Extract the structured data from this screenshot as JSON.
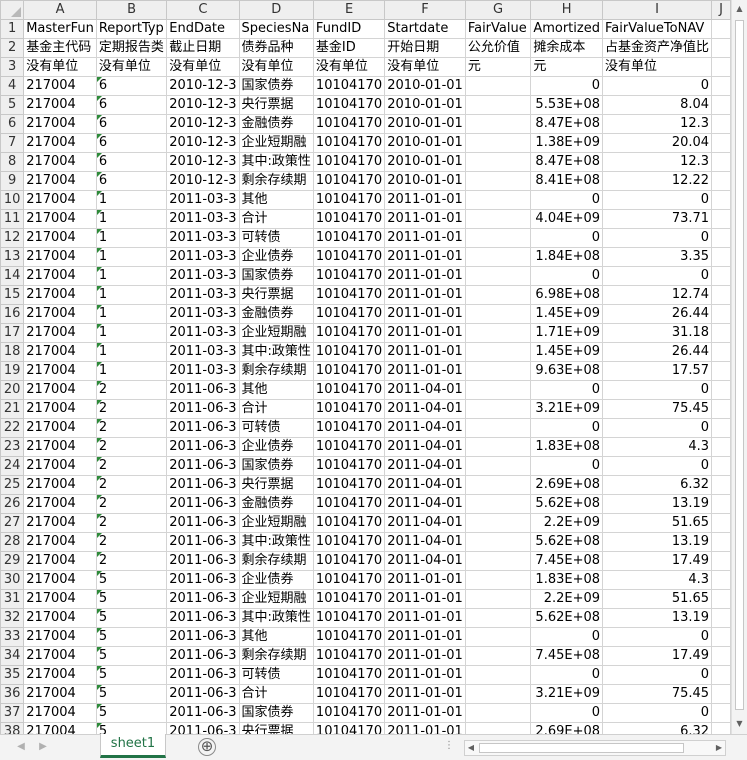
{
  "columns": [
    "A",
    "B",
    "C",
    "D",
    "E",
    "F",
    "G",
    "H",
    "I",
    "J"
  ],
  "rows": [
    {
      "n": "1",
      "c": [
        "MasterFun",
        "ReportTyp",
        "EndDate",
        "SpeciesNa",
        "FundID",
        "Startdate",
        "FairValue",
        "Amortized",
        "FairValueToNAV",
        ""
      ]
    },
    {
      "n": "2",
      "c": [
        "基金主代码",
        "定期报告类",
        "截止日期",
        "债券品种",
        "基金ID",
        "开始日期",
        "公允价值",
        "摊余成本",
        "占基金资产净值比",
        ""
      ]
    },
    {
      "n": "3",
      "c": [
        "没有单位",
        "没有单位",
        "没有单位",
        "没有单位",
        "没有单位",
        "没有单位",
        "元",
        "元",
        "没有单位",
        ""
      ]
    },
    {
      "n": "4",
      "c": [
        "217004",
        "6",
        "2010-12-3",
        "国家债券",
        "10104170",
        "2010-01-01",
        "",
        "0",
        "0",
        ""
      ]
    },
    {
      "n": "5",
      "c": [
        "217004",
        "6",
        "2010-12-3",
        "央行票据",
        "10104170",
        "2010-01-01",
        "",
        "5.53E+08",
        "8.04",
        ""
      ]
    },
    {
      "n": "6",
      "c": [
        "217004",
        "6",
        "2010-12-3",
        "金融债券",
        "10104170",
        "2010-01-01",
        "",
        "8.47E+08",
        "12.3",
        ""
      ]
    },
    {
      "n": "7",
      "c": [
        "217004",
        "6",
        "2010-12-3",
        "企业短期融",
        "10104170",
        "2010-01-01",
        "",
        "1.38E+09",
        "20.04",
        ""
      ]
    },
    {
      "n": "8",
      "c": [
        "217004",
        "6",
        "2010-12-3",
        "其中:政策性",
        "10104170",
        "2010-01-01",
        "",
        "8.47E+08",
        "12.3",
        ""
      ]
    },
    {
      "n": "9",
      "c": [
        "217004",
        "6",
        "2010-12-3",
        "剩余存续期",
        "10104170",
        "2010-01-01",
        "",
        "8.41E+08",
        "12.22",
        ""
      ]
    },
    {
      "n": "10",
      "c": [
        "217004",
        "1",
        "2011-03-3",
        "其他",
        "10104170",
        "2011-01-01",
        "",
        "0",
        "0",
        ""
      ]
    },
    {
      "n": "11",
      "c": [
        "217004",
        "1",
        "2011-03-3",
        "合计",
        "10104170",
        "2011-01-01",
        "",
        "4.04E+09",
        "73.71",
        ""
      ]
    },
    {
      "n": "12",
      "c": [
        "217004",
        "1",
        "2011-03-3",
        "可转债",
        "10104170",
        "2011-01-01",
        "",
        "0",
        "0",
        ""
      ]
    },
    {
      "n": "13",
      "c": [
        "217004",
        "1",
        "2011-03-3",
        "企业债券",
        "10104170",
        "2011-01-01",
        "",
        "1.84E+08",
        "3.35",
        ""
      ]
    },
    {
      "n": "14",
      "c": [
        "217004",
        "1",
        "2011-03-3",
        "国家债券",
        "10104170",
        "2011-01-01",
        "",
        "0",
        "0",
        ""
      ]
    },
    {
      "n": "15",
      "c": [
        "217004",
        "1",
        "2011-03-3",
        "央行票据",
        "10104170",
        "2011-01-01",
        "",
        "6.98E+08",
        "12.74",
        ""
      ]
    },
    {
      "n": "16",
      "c": [
        "217004",
        "1",
        "2011-03-3",
        "金融债券",
        "10104170",
        "2011-01-01",
        "",
        "1.45E+09",
        "26.44",
        ""
      ]
    },
    {
      "n": "17",
      "c": [
        "217004",
        "1",
        "2011-03-3",
        "企业短期融",
        "10104170",
        "2011-01-01",
        "",
        "1.71E+09",
        "31.18",
        ""
      ]
    },
    {
      "n": "18",
      "c": [
        "217004",
        "1",
        "2011-03-3",
        "其中:政策性",
        "10104170",
        "2011-01-01",
        "",
        "1.45E+09",
        "26.44",
        ""
      ]
    },
    {
      "n": "19",
      "c": [
        "217004",
        "1",
        "2011-03-3",
        "剩余存续期",
        "10104170",
        "2011-01-01",
        "",
        "9.63E+08",
        "17.57",
        ""
      ]
    },
    {
      "n": "20",
      "c": [
        "217004",
        "2",
        "2011-06-3",
        "其他",
        "10104170",
        "2011-04-01",
        "",
        "0",
        "0",
        ""
      ]
    },
    {
      "n": "21",
      "c": [
        "217004",
        "2",
        "2011-06-3",
        "合计",
        "10104170",
        "2011-04-01",
        "",
        "3.21E+09",
        "75.45",
        ""
      ]
    },
    {
      "n": "22",
      "c": [
        "217004",
        "2",
        "2011-06-3",
        "可转债",
        "10104170",
        "2011-04-01",
        "",
        "0",
        "0",
        ""
      ]
    },
    {
      "n": "23",
      "c": [
        "217004",
        "2",
        "2011-06-3",
        "企业债券",
        "10104170",
        "2011-04-01",
        "",
        "1.83E+08",
        "4.3",
        ""
      ]
    },
    {
      "n": "24",
      "c": [
        "217004",
        "2",
        "2011-06-3",
        "国家债券",
        "10104170",
        "2011-04-01",
        "",
        "0",
        "0",
        ""
      ]
    },
    {
      "n": "25",
      "c": [
        "217004",
        "2",
        "2011-06-3",
        "央行票据",
        "10104170",
        "2011-04-01",
        "",
        "2.69E+08",
        "6.32",
        ""
      ]
    },
    {
      "n": "26",
      "c": [
        "217004",
        "2",
        "2011-06-3",
        "金融债券",
        "10104170",
        "2011-04-01",
        "",
        "5.62E+08",
        "13.19",
        ""
      ]
    },
    {
      "n": "27",
      "c": [
        "217004",
        "2",
        "2011-06-3",
        "企业短期融",
        "10104170",
        "2011-04-01",
        "",
        "2.2E+09",
        "51.65",
        ""
      ]
    },
    {
      "n": "28",
      "c": [
        "217004",
        "2",
        "2011-06-3",
        "其中:政策性",
        "10104170",
        "2011-04-01",
        "",
        "5.62E+08",
        "13.19",
        ""
      ]
    },
    {
      "n": "29",
      "c": [
        "217004",
        "2",
        "2011-06-3",
        "剩余存续期",
        "10104170",
        "2011-04-01",
        "",
        "7.45E+08",
        "17.49",
        ""
      ]
    },
    {
      "n": "30",
      "c": [
        "217004",
        "5",
        "2011-06-3",
        "企业债券",
        "10104170",
        "2011-01-01",
        "",
        "1.83E+08",
        "4.3",
        ""
      ]
    },
    {
      "n": "31",
      "c": [
        "217004",
        "5",
        "2011-06-3",
        "企业短期融",
        "10104170",
        "2011-01-01",
        "",
        "2.2E+09",
        "51.65",
        ""
      ]
    },
    {
      "n": "32",
      "c": [
        "217004",
        "5",
        "2011-06-3",
        "其中:政策性",
        "10104170",
        "2011-01-01",
        "",
        "5.62E+08",
        "13.19",
        ""
      ]
    },
    {
      "n": "33",
      "c": [
        "217004",
        "5",
        "2011-06-3",
        "其他",
        "10104170",
        "2011-01-01",
        "",
        "0",
        "0",
        ""
      ]
    },
    {
      "n": "34",
      "c": [
        "217004",
        "5",
        "2011-06-3",
        "剩余存续期",
        "10104170",
        "2011-01-01",
        "",
        "7.45E+08",
        "17.49",
        ""
      ]
    },
    {
      "n": "35",
      "c": [
        "217004",
        "5",
        "2011-06-3",
        "可转债",
        "10104170",
        "2011-01-01",
        "",
        "0",
        "0",
        ""
      ]
    },
    {
      "n": "36",
      "c": [
        "217004",
        "5",
        "2011-06-3",
        "合计",
        "10104170",
        "2011-01-01",
        "",
        "3.21E+09",
        "75.45",
        ""
      ]
    },
    {
      "n": "37",
      "c": [
        "217004",
        "5",
        "2011-06-3",
        "国家债券",
        "10104170",
        "2011-01-01",
        "",
        "0",
        "0",
        ""
      ]
    },
    {
      "n": "38",
      "c": [
        "217004",
        "5",
        "2011-06-3",
        "央行票据",
        "10104170",
        "2011-01-01",
        "",
        "2.69E+08",
        "6.32",
        ""
      ]
    }
  ],
  "sheet_tab": "sheet1",
  "add_sheet_symbol": "⊕",
  "hscroll_dots": "⋮"
}
